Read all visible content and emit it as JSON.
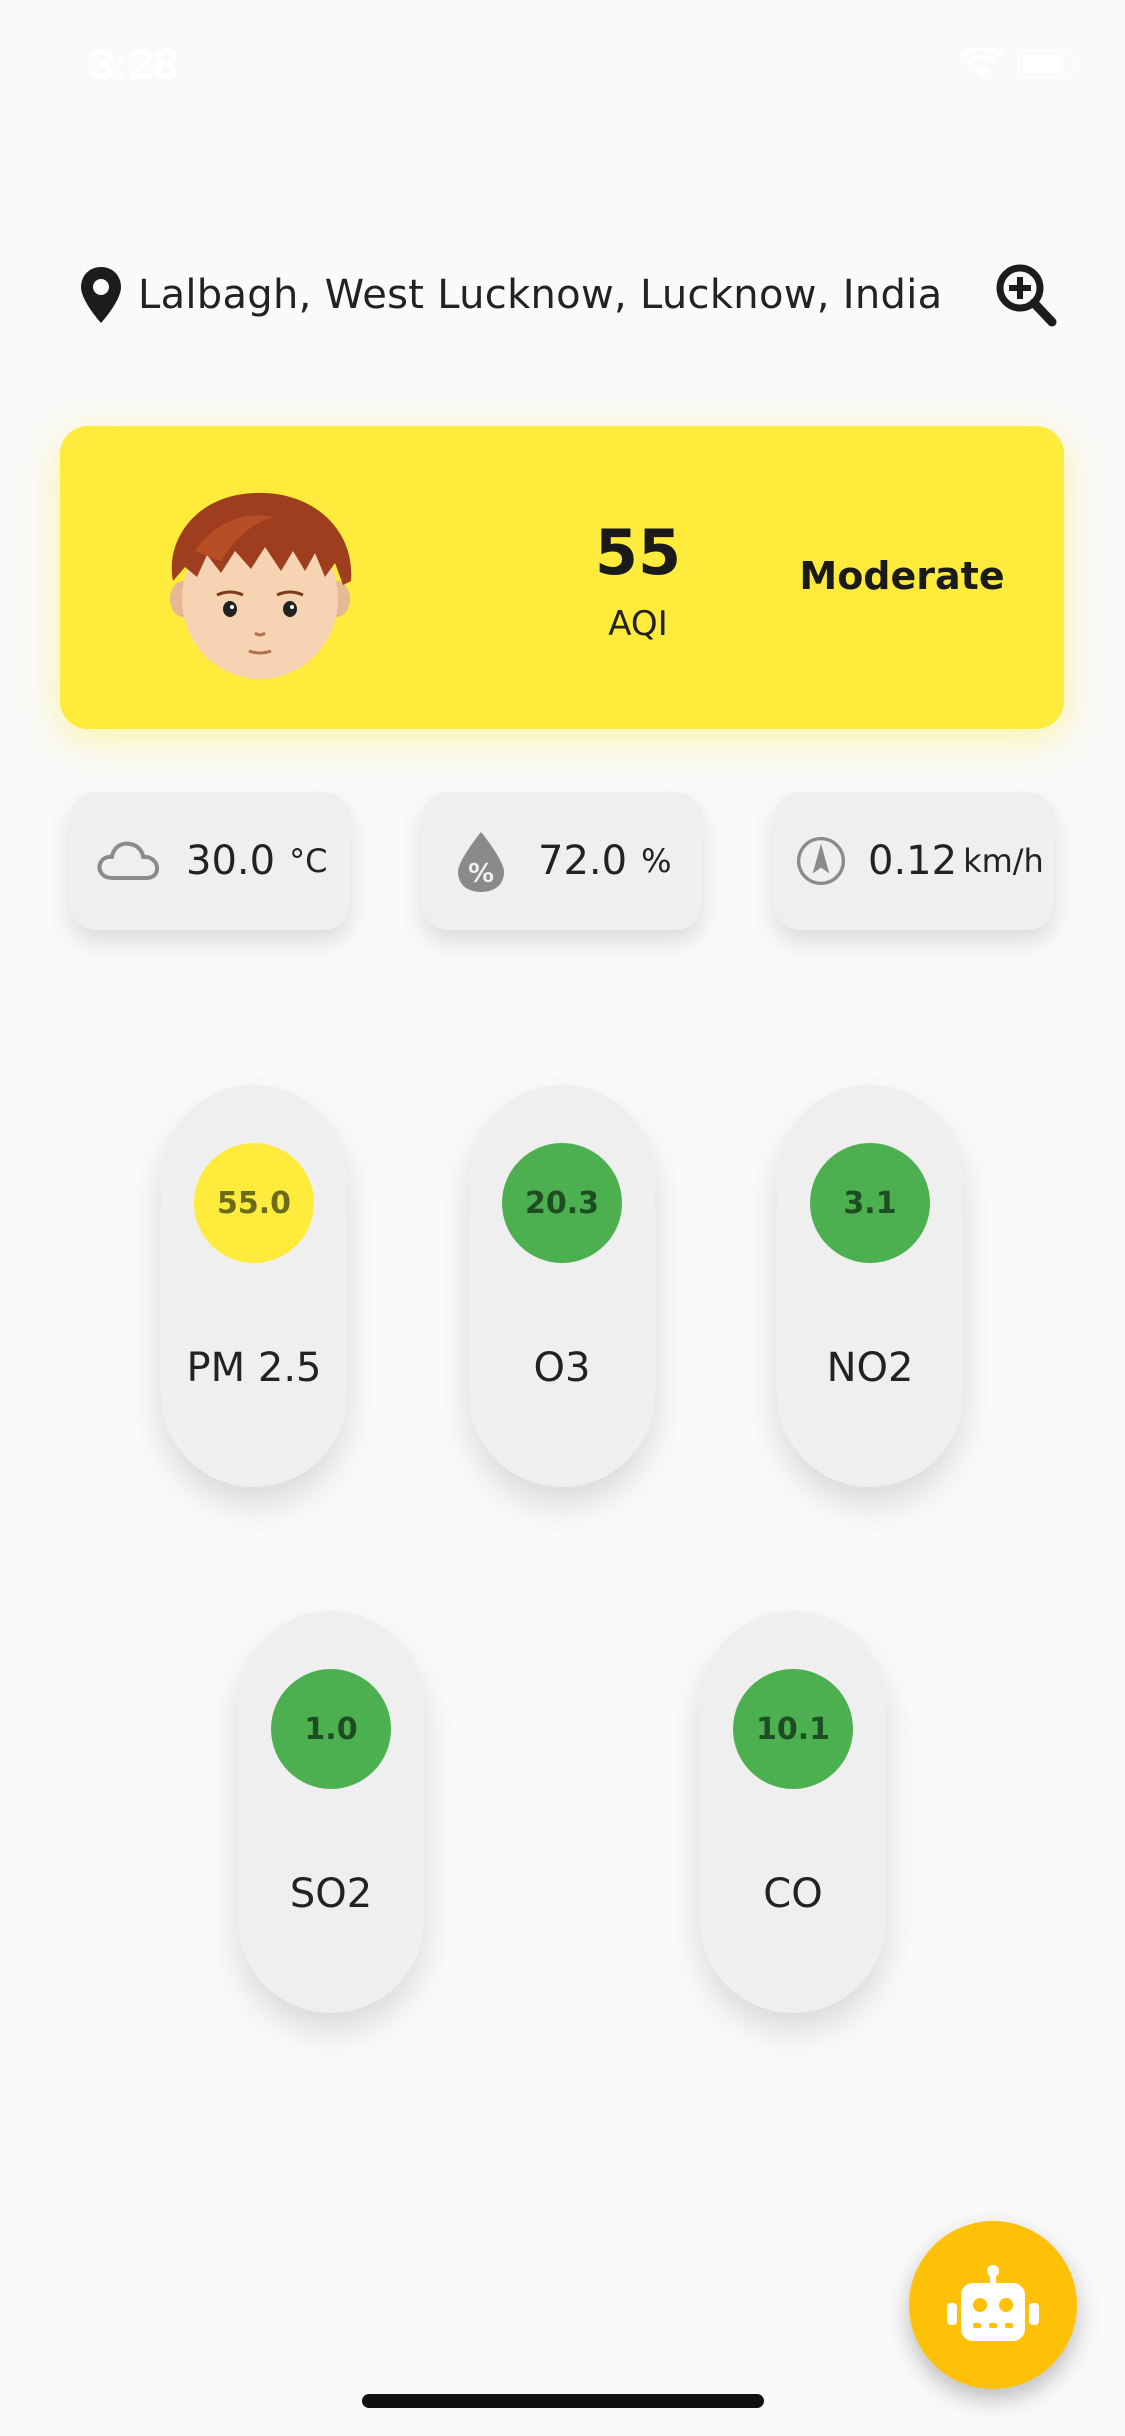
{
  "status_bar": {
    "time": "3:28"
  },
  "location": {
    "text": "Lalbagh, West Lucknow, Lucknow, India"
  },
  "aqi": {
    "value": "55",
    "label": "AQI",
    "status": "Moderate",
    "color": "#ffeb3b"
  },
  "weather": [
    {
      "icon": "cloud-icon",
      "value": "30.0",
      "unit": "°C"
    },
    {
      "icon": "humidity-icon",
      "value": "72.0",
      "unit": "%"
    },
    {
      "icon": "compass-icon",
      "value": "0.12",
      "unit": "km/h"
    }
  ],
  "pollutants": [
    {
      "name": "PM 2.5",
      "value": "55.0",
      "color": "#ffeb3b"
    },
    {
      "name": "O3",
      "value": "20.3",
      "color": "#4caf50"
    },
    {
      "name": "NO2",
      "value": "3.1",
      "color": "#4caf50"
    },
    {
      "name": "SO2",
      "value": "1.0",
      "color": "#4caf50"
    },
    {
      "name": "CO",
      "value": "10.1",
      "color": "#4caf50"
    }
  ],
  "colors": {
    "moderate": "#ffeb3b",
    "good": "#4caf50",
    "fab": "#ffc107"
  },
  "fab": {
    "icon": "robot-icon"
  }
}
